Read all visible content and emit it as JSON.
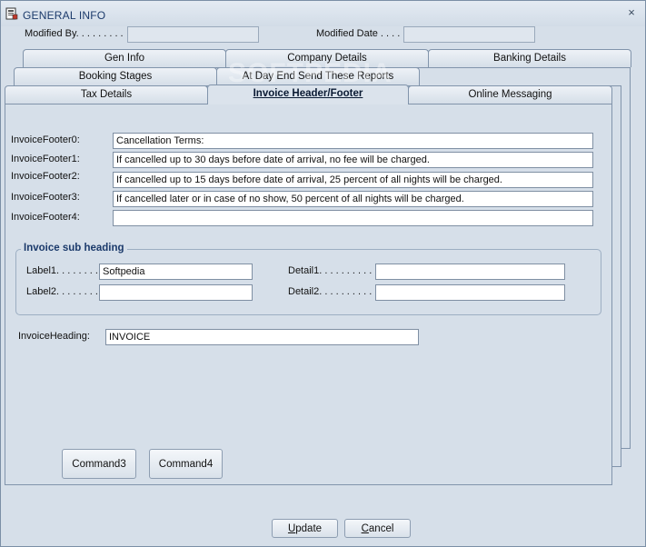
{
  "window": {
    "title": "GENERAL INFO",
    "close_glyph": "×",
    "icon": "app-form-icon"
  },
  "header": {
    "modified_by_label": "Modified By. . . . . . . . .",
    "modified_by_value": "",
    "modified_date_label": "Modified Date  . . . .",
    "modified_date_value": ""
  },
  "tabs": {
    "row1": [
      "Gen Info",
      "Company Details",
      "Banking Details"
    ],
    "row2": [
      "Booking Stages",
      "At Day End Send These Reports"
    ],
    "row3": [
      "Tax Details",
      "Invoice Header/Footer",
      "Online Messaging"
    ],
    "active": "Invoice Header/Footer"
  },
  "footers": [
    {
      "label": "InvoiceFooter0:",
      "value": "Cancellation Terms:"
    },
    {
      "label": "InvoiceFooter1:",
      "value": "If cancelled up to 30 days before date of arrival, no fee will be charged."
    },
    {
      "label": "InvoiceFooter2:",
      "value": "If cancelled up to 15 days before date of arrival, 25 percent of all nights will be charged."
    },
    {
      "label": "InvoiceFooter3:",
      "value": "If cancelled later or in case of no show, 50 percent of all nights will be charged."
    },
    {
      "label": "InvoiceFooter4:",
      "value": ""
    }
  ],
  "subheading": {
    "title": "Invoice sub heading",
    "label1_label": "Label1. . . . . . . .",
    "label1_value": "Softpedia",
    "label2_label": "Label2. . . . . . . .",
    "label2_value": "",
    "detail1_label": "Detail1. . . . . . . . . .",
    "detail1_value": "",
    "detail2_label": "Detail2. . . . . . . . . .",
    "detail2_value": ""
  },
  "heading": {
    "label": "InvoiceHeading:",
    "value": "INVOICE"
  },
  "commands": {
    "command3": "Command3",
    "command4": "Command4"
  },
  "actions": {
    "update_pre": "",
    "update_key": "U",
    "update_post": "pdate",
    "cancel_pre": "",
    "cancel_key": "C",
    "cancel_post": "ancel"
  },
  "watermark": "SOFTPEDIA"
}
